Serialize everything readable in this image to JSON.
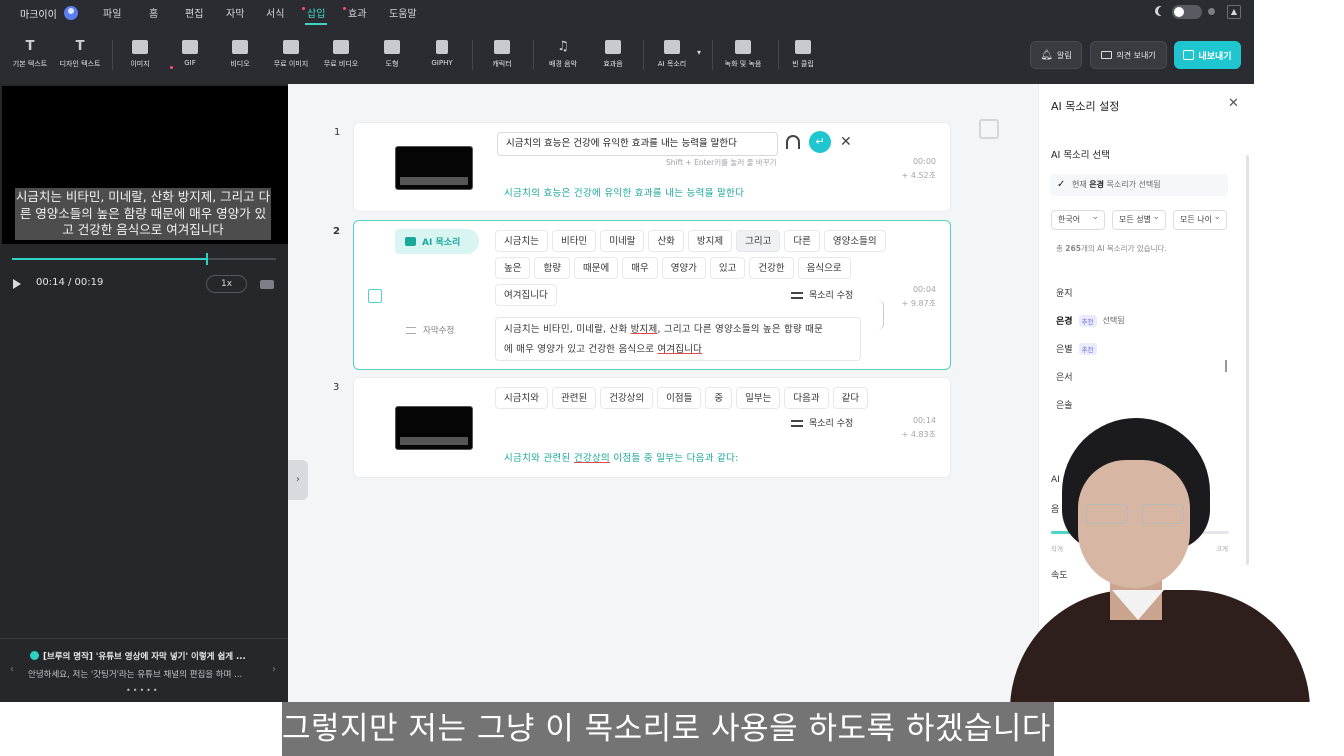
{
  "app": {
    "user_name": "마크이이"
  },
  "menu": [
    {
      "label": "파일"
    },
    {
      "label": "홈"
    },
    {
      "label": "편집"
    },
    {
      "label": "자막"
    },
    {
      "label": "서식"
    },
    {
      "label": "삽입"
    },
    {
      "label": "효과"
    },
    {
      "label": "도움말"
    }
  ],
  "toolbar": [
    {
      "label": "기본 텍스트",
      "icon": "text-icon"
    },
    {
      "label": "디자인 텍스트",
      "icon": "design-text-icon"
    },
    {
      "label": "이미지",
      "icon": "image-icon"
    },
    {
      "label": "GIF",
      "icon": "gif-icon"
    },
    {
      "label": "비디오",
      "icon": "video-icon"
    },
    {
      "label": "무료 이미지",
      "icon": "free-image-icon"
    },
    {
      "label": "무료 비디오",
      "icon": "free-video-icon"
    },
    {
      "label": "도형",
      "icon": "shapes-icon"
    },
    {
      "label": "GIPHY",
      "icon": "giphy-icon"
    },
    {
      "label": "캐릭터",
      "icon": "character-icon"
    },
    {
      "label": "배경 음악",
      "icon": "music-icon"
    },
    {
      "label": "효과음",
      "icon": "sound-effect-icon"
    },
    {
      "label": "AI 목소리",
      "icon": "ai-voice-icon"
    },
    {
      "label": "녹화 및 녹음",
      "icon": "record-icon"
    },
    {
      "label": "빈 클립",
      "icon": "blank-clip-icon"
    }
  ],
  "actions": {
    "alarm": "알림",
    "feedback": "의견 보내기",
    "export": "내보내기"
  },
  "preview": {
    "caption": "시금치는 비타민, 미네랄, 산화 방지제, 그리고 다른 영양소들의 높은 함량 때문에 매우 영양가 있고 건강한 음식으로 여겨집니다",
    "time": "00:14 / 00:19",
    "progress": 0.74,
    "speed": "1x"
  },
  "notice": {
    "title": "[브루의 명작] '유튜브 영상에 자막 넣기' 이렇게 쉽게 ...",
    "body": "안녕하세요, 저는 '갓팅거'라는 유튜브 채널의 편집을 하며 ..."
  },
  "clips": [
    {
      "num": "1",
      "edit_value": "시금치의 효능은 건강에 유익한 효과를 내는 능력을 말한다",
      "edit_hint": "Shift + Enter키를 눌러 줄 바꾸기",
      "time": "00:00",
      "duration": "+ 4.52초",
      "subtitle": "시금치의 효능은 건강에 유익한 효과를 내는 능력을 말한다"
    },
    {
      "num": "2",
      "tag": "AI 목소리",
      "words": [
        "시금치는",
        "비타민",
        "미네랄",
        "산화",
        "방지제",
        "그리고",
        "다른",
        "영양소들의",
        "높은",
        "함량",
        "때문에",
        "매우",
        "영양가",
        "있고",
        "건강한",
        "음식으로",
        "여겨집니다"
      ],
      "voice_edit": "목소리 수정",
      "time": "00:04",
      "duration": "+ 9.87초",
      "sub_edit_label": "자막수정",
      "subtitle_pre": "시금치는 비타민, 미네랄, 산화 ",
      "subtitle_u1": "방지제",
      "subtitle_mid": ", 그리고 다른 영양소들의 높은 함량 때문",
      "subtitle_line2_pre": "에 매우 영양가 있고 건강한 음식으로 ",
      "subtitle_u2": "여겨집니다"
    },
    {
      "num": "3",
      "words": [
        "시금치와",
        "관련된",
        "건강상의",
        "이점들",
        "중",
        "일부는",
        "다음과",
        "같다"
      ],
      "voice_edit": "목소리 수정",
      "time": "00:14",
      "duration": "+ 4.83초",
      "subtitle_pre": "시금치와 관련된 ",
      "subtitle_u": "건강상의",
      "subtitle_post": " 이점들 중 일부는 다음과 같다:"
    }
  ],
  "voice_panel": {
    "title": "AI 목소리 설정",
    "section": "AI 목소리 선택",
    "current_pre": "현재 ",
    "current_name": "은경",
    "current_post": " 목소리가 선택됨",
    "filters": [
      "한국어",
      "모든 성별",
      "모든 나이"
    ],
    "count_pre": "총 ",
    "count_num": "265",
    "count_post": "개의 AI 목소리가 있습니다.",
    "voices": [
      {
        "name": "윤지",
        "badge": "",
        "selected_text": ""
      },
      {
        "name": "은경",
        "badge": "추천",
        "selected_text": "선택됨"
      },
      {
        "name": "은별",
        "badge": "추천",
        "selected_text": ""
      },
      {
        "name": "은서",
        "badge": "",
        "selected_text": ""
      },
      {
        "name": "은솔",
        "badge": "",
        "selected_text": ""
      }
    ],
    "lower_partial_1": "AI",
    "lower_partial_2": "음",
    "speed_label": "속도",
    "volume_low": "작게",
    "volume_high": "크게",
    "volume_level": 0.2
  },
  "burned_caption": "그렇지만 저는 그냥 이 목소리로 사용을 하도록 하겠습니다."
}
